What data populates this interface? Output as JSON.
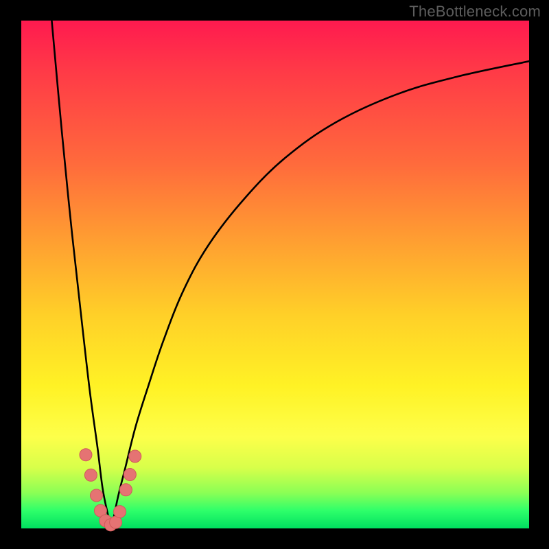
{
  "watermark": "TheBottleneck.com",
  "colors": {
    "frame_bg": "#000000",
    "curve_stroke": "#000000",
    "marker_fill": "#e57373",
    "marker_stroke": "#cf5a5a"
  },
  "chart_data": {
    "type": "line",
    "title": "",
    "xlabel": "",
    "ylabel": "",
    "xlim": [
      0,
      100
    ],
    "ylim": [
      0,
      100
    ],
    "grid": false,
    "series": [
      {
        "name": "left-branch",
        "x": [
          6,
          8,
          10,
          12,
          13.5,
          15,
          16,
          17,
          17.8
        ],
        "values": [
          100,
          78,
          58,
          40,
          27,
          16,
          8,
          3,
          0
        ]
      },
      {
        "name": "right-branch",
        "x": [
          17.8,
          19,
          20.5,
          22.5,
          25,
          28,
          32,
          37,
          44,
          52,
          62,
          74,
          86,
          100
        ],
        "values": [
          0,
          6,
          12,
          20,
          28,
          37,
          47,
          56,
          65,
          73,
          80,
          85.5,
          89,
          92
        ]
      }
    ],
    "markers": [
      {
        "x": 12.7,
        "y": 14.5
      },
      {
        "x": 13.7,
        "y": 10.5
      },
      {
        "x": 14.8,
        "y": 6.5
      },
      {
        "x": 15.6,
        "y": 3.5
      },
      {
        "x": 16.6,
        "y": 1.5
      },
      {
        "x": 17.6,
        "y": 0.7
      },
      {
        "x": 18.6,
        "y": 1.2
      },
      {
        "x": 19.4,
        "y": 3.3
      },
      {
        "x": 20.6,
        "y": 7.6
      },
      {
        "x": 21.4,
        "y": 10.6
      },
      {
        "x": 22.4,
        "y": 14.2
      }
    ],
    "marker_radius": 9
  }
}
